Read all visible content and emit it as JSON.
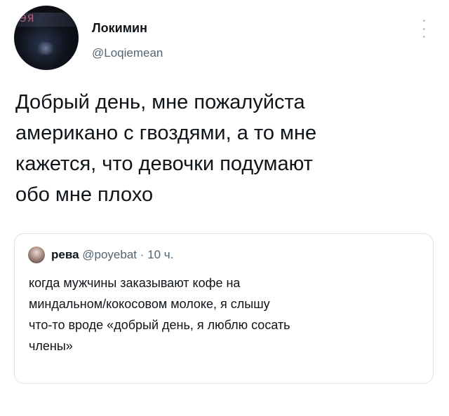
{
  "tweet": {
    "avatar_text": "ЭЯ",
    "display_name": "Локимин",
    "handle": "@Loqiemean",
    "text": "Добрый день, мне пожалуйста\nамерикано с гвоздями, а то мне\nкажется, что девочки подумают\nобо мне плохо"
  },
  "quote": {
    "name": "рева",
    "handle": "@poyebat",
    "separator": "·",
    "time": "10 ч.",
    "text": "когда мужчины заказывают кофе на\nминдальном/кокосовом молоке, я слышу\nчто-то вроде «добрый день, я люблю сосать\nчлены»"
  },
  "icons": {
    "more": "more-vertical-icon"
  },
  "colors": {
    "text_primary": "#0f1419",
    "text_secondary": "#536471",
    "border": "#dfe3e6",
    "background": "#ffffff"
  }
}
